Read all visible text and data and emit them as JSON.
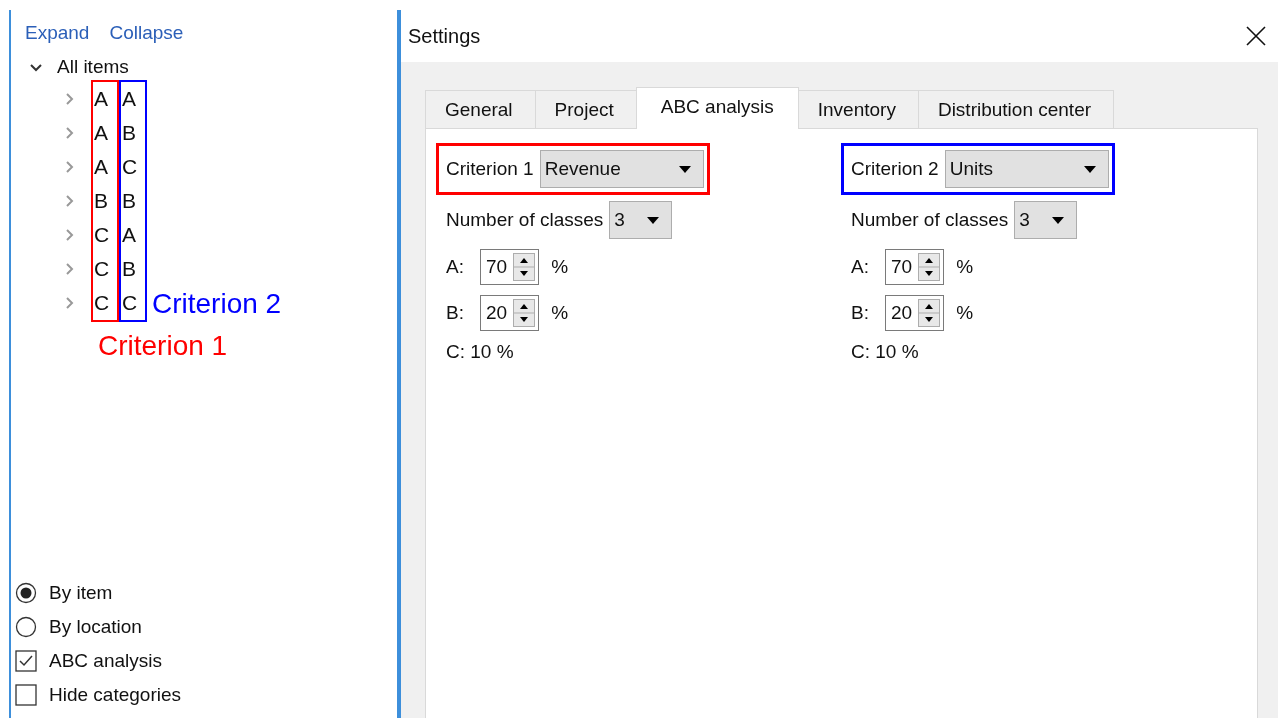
{
  "tree_panel": {
    "links": [
      {
        "label": "Expand"
      },
      {
        "label": "Collapse"
      }
    ],
    "tree": {
      "label": "All items",
      "expanded": true,
      "children": [
        {
          "criterion_1": "A",
          "criterion_2": "A",
          "expanded": false
        },
        {
          "criterion_1": "A",
          "criterion_2": "B",
          "expanded": false
        },
        {
          "criterion_1": "A",
          "criterion_2": "C",
          "expanded": false
        },
        {
          "criterion_1": "B",
          "criterion_2": "B",
          "expanded": false
        },
        {
          "criterion_1": "C",
          "criterion_2": "A",
          "expanded": false
        },
        {
          "criterion_1": "C",
          "criterion_2": "B",
          "expanded": false
        },
        {
          "criterion_1": "C",
          "criterion_2": "C",
          "expanded": false
        }
      ]
    },
    "annotations": [
      {
        "text": "Criterion 2",
        "color": "#0000ff"
      },
      {
        "text": "Criterion 1",
        "color": "#ff0000"
      }
    ],
    "options": [
      {
        "kind": "radio",
        "label": "By item",
        "checked": true
      },
      {
        "kind": "radio",
        "label": "By location",
        "checked": false
      },
      {
        "kind": "checkbox",
        "label": "ABC analysis",
        "checked": true
      },
      {
        "kind": "checkbox",
        "label": "Hide categories",
        "checked": false
      }
    ]
  },
  "dialog": {
    "title": "Settings",
    "tabs": [
      {
        "label": "General",
        "selected": false
      },
      {
        "label": "Project",
        "selected": false
      },
      {
        "label": "ABC analysis",
        "selected": true
      },
      {
        "label": "Inventory",
        "selected": false
      },
      {
        "label": "Distribution center",
        "selected": false
      }
    ],
    "criteria": [
      {
        "label": "Criterion 1",
        "value": "Revenue",
        "color": "#ff0000",
        "classes_label": "Number of classes",
        "classes": "3",
        "rows": [
          {
            "label": "A:",
            "value": "70",
            "unit": "%"
          },
          {
            "label": "B:",
            "value": "20",
            "unit": "%"
          }
        ],
        "remainder": "C: 10 %"
      },
      {
        "label": "Criterion 2",
        "value": "Units",
        "color": "#0000ff",
        "classes_label": "Number of classes",
        "classes": "3",
        "rows": [
          {
            "label": "A:",
            "value": "70",
            "unit": "%"
          },
          {
            "label": "B:",
            "value": "20",
            "unit": "%"
          }
        ],
        "remainder": "C: 10 %"
      }
    ]
  }
}
